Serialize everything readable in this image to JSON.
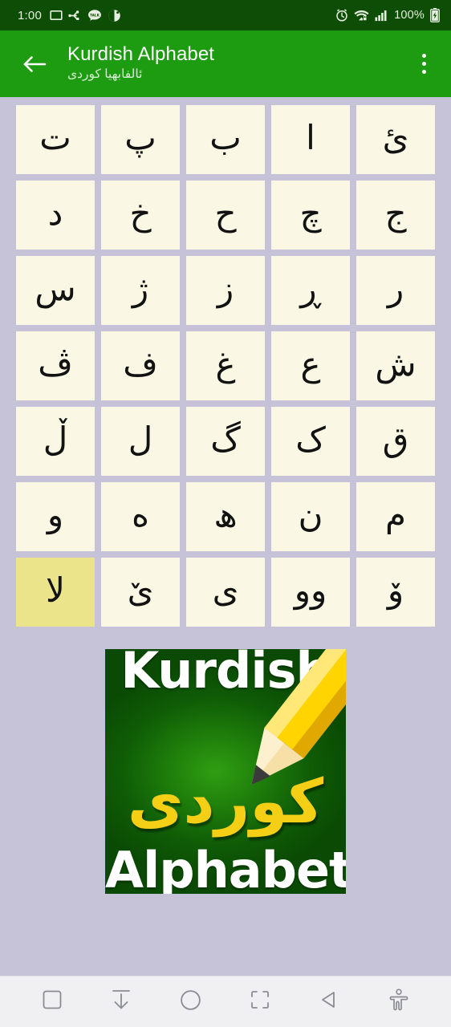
{
  "statusbar": {
    "time": "1:00",
    "battery_percent": "100%",
    "left_icons": [
      "message-icon",
      "usb-icon",
      "talk-chat-icon",
      "contrast-circle-icon"
    ],
    "right_icons": [
      "alarm-icon",
      "wifi-secure-icon",
      "signal-bars-icon",
      "battery-icon"
    ],
    "bg_color": "#0d4d05"
  },
  "appbar": {
    "back_label": "back-arrow",
    "title": "Kurdish Alphabet",
    "subtitle": "ئالفابهیا کوردی",
    "overflow_label": "more-options",
    "bg_color": "#1d9c12"
  },
  "grid": {
    "bg_color": "#c6c2d8",
    "cell_color": "#faf8e4",
    "selected_color": "#ece48a",
    "selected_letter": "لا",
    "rows": [
      [
        "ئ",
        "ا",
        "ب",
        "پ",
        "ت"
      ],
      [
        "ج",
        "چ",
        "ح",
        "خ",
        "د"
      ],
      [
        "ر",
        "ڕ",
        "ز",
        "ژ",
        "س"
      ],
      [
        "ش",
        "ع",
        "غ",
        "ف",
        "ڤ"
      ],
      [
        "ق",
        "ک",
        "گ",
        "ل",
        "ڵ"
      ],
      [
        "م",
        "ن",
        "ھ",
        "ە",
        "و"
      ],
      [
        "ۆ",
        "وو",
        "ی",
        "ێ",
        "لا"
      ]
    ]
  },
  "banner": {
    "top_text": "Kurdish",
    "bottom_text": "Alphabet",
    "kurdish_text": "کوردی",
    "green_color": "#1d7a0a",
    "yellow_color": "#f5cf16",
    "icons": [
      "pencil-icon"
    ]
  },
  "navbar": {
    "bg_color": "#f0f0f2",
    "items": [
      {
        "name": "recents-button",
        "icon": "square-icon"
      },
      {
        "name": "download-button",
        "icon": "arrow-down-bar-icon"
      },
      {
        "name": "home-button",
        "icon": "circle-icon"
      },
      {
        "name": "screenshot-button",
        "icon": "crop-brackets-icon"
      },
      {
        "name": "back-button",
        "icon": "triangle-left-icon"
      },
      {
        "name": "accessibility-button",
        "icon": "accessibility-person-icon"
      }
    ]
  }
}
